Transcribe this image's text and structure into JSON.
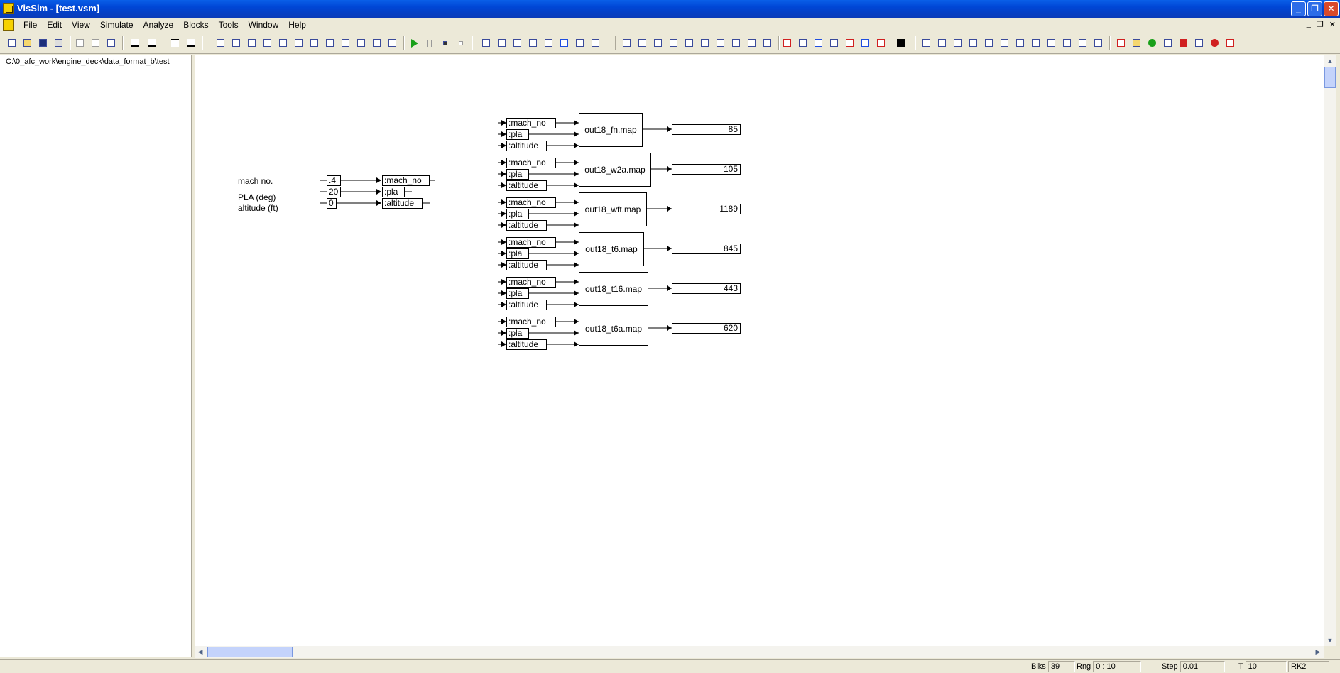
{
  "window": {
    "title": "VisSim - [test.vsm]",
    "buttons": [
      "_",
      "❐",
      "✕"
    ]
  },
  "menu": {
    "items": [
      "File",
      "Edit",
      "View",
      "Simulate",
      "Analyze",
      "Blocks",
      "Tools",
      "Window",
      "Help"
    ],
    "mdi_buttons": [
      "_",
      "❐",
      "✕"
    ]
  },
  "tree": {
    "path": "C:\\0_afc_work\\engine_deck\\data_format_b\\test"
  },
  "inputs": {
    "mach_label": "mach no.",
    "pla_label": "PLA (deg)",
    "alt_label": "altitude (ft)",
    "mach_value": ".4",
    "pla_value": "20",
    "alt_value": "0",
    "mach_var": ":mach_no",
    "pla_var": ":pla",
    "alt_var": ":altitude"
  },
  "maps": [
    {
      "in1": ":mach_no",
      "in2": ":pla",
      "in3": ":altitude",
      "name": "out18_fn.map",
      "value": "85"
    },
    {
      "in1": ":mach_no",
      "in2": ":pla",
      "in3": ":altitude",
      "name": "out18_w2a.map",
      "value": "105"
    },
    {
      "in1": ":mach_no",
      "in2": ":pla",
      "in3": ":altitude",
      "name": "out18_wft.map",
      "value": "1189"
    },
    {
      "in1": ":mach_no",
      "in2": ":pla",
      "in3": ":altitude",
      "name": "out18_t6.map",
      "value": "845"
    },
    {
      "in1": ":mach_no",
      "in2": ":pla",
      "in3": ":altitude",
      "name": "out18_t16.map",
      "value": "443"
    },
    {
      "in1": ":mach_no",
      "in2": ":pla",
      "in3": ":altitude",
      "name": "out18_t6a.map",
      "value": "620"
    }
  ],
  "status": {
    "blks_label": "Blks",
    "blks_value": "39",
    "rng_label": "Rng",
    "rng_value": "0 : 10",
    "step_label": "Step",
    "step_value": "0.01",
    "t_label": "T",
    "t_value": "10",
    "method": "RK2"
  },
  "colors": {
    "titlebar": "#0046d5",
    "play": "#19a019"
  }
}
